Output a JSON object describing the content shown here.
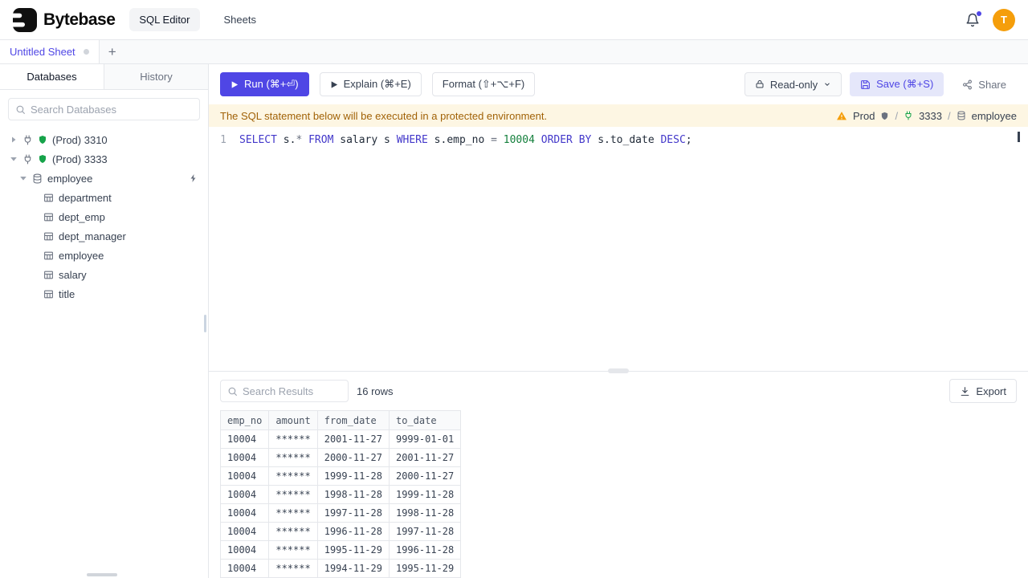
{
  "colors": {
    "accent": "#4f46e5",
    "keyword": "#4338ca",
    "number": "#15803d",
    "banner_bg": "#fdf6e3",
    "banner_text": "#a16207",
    "avatar_bg": "#f59e0b"
  },
  "header": {
    "brand": "Bytebase",
    "nav": [
      {
        "label": "SQL Editor",
        "active": true
      },
      {
        "label": "Sheets",
        "active": false
      }
    ],
    "avatar_letter": "T"
  },
  "sheet_tabs": {
    "active_tab": "Untitled Sheet",
    "add_button": "+"
  },
  "sidebar": {
    "tabs": [
      {
        "label": "Databases",
        "active": true
      },
      {
        "label": "History",
        "active": false
      }
    ],
    "search_placeholder": "Search Databases",
    "tree": [
      {
        "label": "(Prod) 3310",
        "level": 0,
        "caret": "right",
        "icons": [
          "instance-icon",
          "shield-icon"
        ]
      },
      {
        "label": "(Prod) 3333",
        "level": 0,
        "caret": "down",
        "icons": [
          "instance-icon",
          "shield-icon"
        ]
      },
      {
        "label": "employee",
        "level": 1,
        "caret": "down",
        "icons": [
          "database-icon"
        ],
        "trailing": "bolt-icon"
      },
      {
        "label": "department",
        "level": 2,
        "icons": [
          "table-icon"
        ]
      },
      {
        "label": "dept_emp",
        "level": 2,
        "icons": [
          "table-icon"
        ]
      },
      {
        "label": "dept_manager",
        "level": 2,
        "icons": [
          "table-icon"
        ]
      },
      {
        "label": "employee",
        "level": 2,
        "icons": [
          "table-icon"
        ]
      },
      {
        "label": "salary",
        "level": 2,
        "icons": [
          "table-icon"
        ]
      },
      {
        "label": "title",
        "level": 2,
        "icons": [
          "table-icon"
        ]
      }
    ]
  },
  "toolbar": {
    "run": "Run (⌘+⏎)",
    "explain": "Explain (⌘+E)",
    "format": "Format (⇧+⌥+F)",
    "readonly": "Read-only",
    "save": "Save (⌘+S)",
    "share": "Share"
  },
  "banner": {
    "message": "The SQL statement below will be executed in a protected environment.",
    "environment": "Prod",
    "separator": "/",
    "instance": "3333",
    "database": "employee"
  },
  "editor": {
    "line_number": "1",
    "sql_text": "SELECT s.* FROM salary s WHERE s.emp_no = 10004 ORDER BY s.to_date DESC;",
    "tokens": [
      {
        "text": "SELECT",
        "type": "kw"
      },
      {
        "text": " s.",
        "type": "id"
      },
      {
        "text": "*",
        "type": "op"
      },
      {
        "text": " ",
        "type": "id"
      },
      {
        "text": "FROM",
        "type": "kw"
      },
      {
        "text": " salary s ",
        "type": "id"
      },
      {
        "text": "WHERE",
        "type": "kw"
      },
      {
        "text": " s.emp_no ",
        "type": "id"
      },
      {
        "text": "=",
        "type": "op"
      },
      {
        "text": " ",
        "type": "id"
      },
      {
        "text": "10004",
        "type": "num"
      },
      {
        "text": " ",
        "type": "id"
      },
      {
        "text": "ORDER BY",
        "type": "kw"
      },
      {
        "text": " s.to_date ",
        "type": "id"
      },
      {
        "text": "DESC",
        "type": "kw"
      },
      {
        "text": ";",
        "type": "id"
      }
    ]
  },
  "results": {
    "search_placeholder": "Search Results",
    "row_count": "16 rows",
    "export": "Export",
    "columns": [
      "emp_no",
      "amount",
      "from_date",
      "to_date"
    ],
    "rows": [
      [
        "10004",
        "******",
        "2001-11-27",
        "9999-01-01"
      ],
      [
        "10004",
        "******",
        "2000-11-27",
        "2001-11-27"
      ],
      [
        "10004",
        "******",
        "1999-11-28",
        "2000-11-27"
      ],
      [
        "10004",
        "******",
        "1998-11-28",
        "1999-11-28"
      ],
      [
        "10004",
        "******",
        "1997-11-28",
        "1998-11-28"
      ],
      [
        "10004",
        "******",
        "1996-11-28",
        "1997-11-28"
      ],
      [
        "10004",
        "******",
        "1995-11-29",
        "1996-11-28"
      ],
      [
        "10004",
        "******",
        "1994-11-29",
        "1995-11-29"
      ]
    ]
  }
}
